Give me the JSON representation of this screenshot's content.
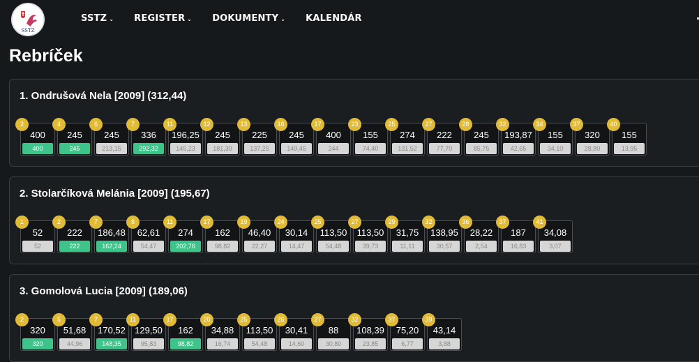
{
  "nav": {
    "logo_text": "SSTZ",
    "items": [
      {
        "label": "SSTZ",
        "dropdown": true
      },
      {
        "label": "REGISTER",
        "dropdown": true
      },
      {
        "label": "DOKUMENTY",
        "dropdown": true
      },
      {
        "label": "KALENDÁR",
        "dropdown": false
      }
    ]
  },
  "page_title": "Rebríček",
  "colors": {
    "badge": "#e2bb36",
    "counted": "#3ec38a",
    "not_counted": "#d6d6d6",
    "background": "#16191c"
  },
  "players": [
    {
      "title": "1. Ondrušová Nela [2009] (312,44)",
      "tournaments": [
        {
          "rank": "2",
          "points": "400",
          "sub": "400",
          "counted": true
        },
        {
          "rank": "4",
          "points": "245",
          "sub": "245",
          "counted": true
        },
        {
          "rank": "6",
          "points": "245",
          "sub": "213,15",
          "counted": false
        },
        {
          "rank": "7",
          "points": "336",
          "sub": "292,32",
          "counted": true
        },
        {
          "rank": "11",
          "points": "196,25",
          "sub": "145,23",
          "counted": false
        },
        {
          "rank": "12",
          "points": "245",
          "sub": "181,30",
          "counted": false
        },
        {
          "rank": "13",
          "points": "225",
          "sub": "137,25",
          "counted": false
        },
        {
          "rank": "16",
          "points": "245",
          "sub": "149,45",
          "counted": false
        },
        {
          "rank": "17",
          "points": "400",
          "sub": "244",
          "counted": false
        },
        {
          "rank": "23",
          "points": "155",
          "sub": "74,40",
          "counted": false
        },
        {
          "rank": "25",
          "points": "274",
          "sub": "131,52",
          "counted": false
        },
        {
          "rank": "27",
          "points": "222",
          "sub": "77,70",
          "counted": false
        },
        {
          "rank": "28",
          "points": "245",
          "sub": "85,75",
          "counted": false
        },
        {
          "rank": "32",
          "points": "193,87",
          "sub": "42,65",
          "counted": false
        },
        {
          "rank": "34",
          "points": "155",
          "sub": "34,10",
          "counted": false
        },
        {
          "rank": "37",
          "points": "320",
          "sub": "28,80",
          "counted": false
        },
        {
          "rank": "40",
          "points": "155",
          "sub": "13,95",
          "counted": false
        }
      ]
    },
    {
      "title": "2. Stolarčíková Melánia [2009] (195,67)",
      "tournaments": [
        {
          "rank": "1",
          "points": "52",
          "sub": "52",
          "counted": false
        },
        {
          "rank": "2",
          "points": "222",
          "sub": "222",
          "counted": true
        },
        {
          "rank": "7",
          "points": "186,48",
          "sub": "162,24",
          "counted": true
        },
        {
          "rank": "8",
          "points": "62,61",
          "sub": "54,47",
          "counted": false
        },
        {
          "rank": "11",
          "points": "274",
          "sub": "202,76",
          "counted": true
        },
        {
          "rank": "17",
          "points": "162",
          "sub": "98,82",
          "counted": false
        },
        {
          "rank": "19",
          "points": "46,40",
          "sub": "22,27",
          "counted": false
        },
        {
          "rank": "24",
          "points": "30,14",
          "sub": "14,47",
          "counted": false
        },
        {
          "rank": "25",
          "points": "113,50",
          "sub": "54,48",
          "counted": false
        },
        {
          "rank": "27",
          "points": "113,50",
          "sub": "39,73",
          "counted": false
        },
        {
          "rank": "29",
          "points": "31,75",
          "sub": "11,11",
          "counted": false
        },
        {
          "rank": "32",
          "points": "138,95",
          "sub": "30,57",
          "counted": false
        },
        {
          "rank": "36",
          "points": "28,22",
          "sub": "2,54",
          "counted": false
        },
        {
          "rank": "37",
          "points": "187",
          "sub": "16,83",
          "counted": false
        },
        {
          "rank": "41",
          "points": "34,08",
          "sub": "3,07",
          "counted": false
        }
      ]
    },
    {
      "title": "3. Gomolová Lucia [2009] (189,06)",
      "tournaments": [
        {
          "rank": "2",
          "points": "320",
          "sub": "320",
          "counted": true
        },
        {
          "rank": "5",
          "points": "51,68",
          "sub": "44,96",
          "counted": false
        },
        {
          "rank": "7",
          "points": "170,52",
          "sub": "148,35",
          "counted": true
        },
        {
          "rank": "11",
          "points": "129,50",
          "sub": "95,83",
          "counted": false
        },
        {
          "rank": "17",
          "points": "162",
          "sub": "98,82",
          "counted": true
        },
        {
          "rank": "20",
          "points": "34,88",
          "sub": "16,74",
          "counted": false
        },
        {
          "rank": "25",
          "points": "113,50",
          "sub": "54,48",
          "counted": false
        },
        {
          "rank": "26",
          "points": "30,41",
          "sub": "14,60",
          "counted": false
        },
        {
          "rank": "27",
          "points": "88",
          "sub": "30,80",
          "counted": false
        },
        {
          "rank": "32",
          "points": "108,39",
          "sub": "23,85",
          "counted": false
        },
        {
          "rank": "37",
          "points": "75,20",
          "sub": "6,77",
          "counted": false
        },
        {
          "rank": "39",
          "points": "43,14",
          "sub": "3,88",
          "counted": false
        }
      ]
    }
  ]
}
